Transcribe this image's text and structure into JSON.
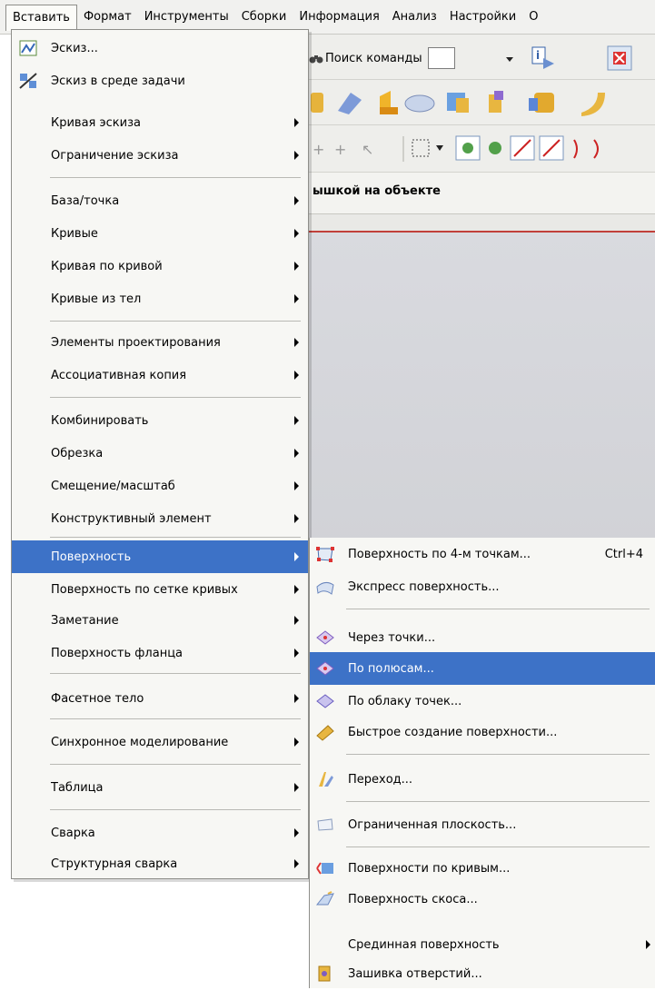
{
  "menubar": {
    "items": [
      {
        "label": "Вставить"
      },
      {
        "label": "Формат"
      },
      {
        "label": "Инструменты"
      },
      {
        "label": "Сборки"
      },
      {
        "label": "Информация"
      },
      {
        "label": "Анализ"
      },
      {
        "label": "Настройки"
      },
      {
        "label": "О"
      }
    ]
  },
  "toolbar": {
    "search_label": "Поиск команды"
  },
  "header": {
    "title": "ышкой на объекте"
  },
  "insert_menu": {
    "items": [
      {
        "label": "Эскиз...",
        "icon": "sketch-icon"
      },
      {
        "label": "Эскиз в среде задачи",
        "icon": "task-sketch-icon"
      },
      {
        "label": "Кривая эскиза"
      },
      {
        "label": "Ограничение эскиза"
      },
      {
        "label": "База/точка"
      },
      {
        "label": "Кривые"
      },
      {
        "label": "Кривая по кривой"
      },
      {
        "label": "Кривые из тел"
      },
      {
        "label": "Элементы проектирования"
      },
      {
        "label": "Ассоциативная копия"
      },
      {
        "label": "Комбинировать"
      },
      {
        "label": "Обрезка"
      },
      {
        "label": "Смещение/масштаб"
      },
      {
        "label": "Конструктивный элемент"
      },
      {
        "label": "Поверхность"
      },
      {
        "label": "Поверхность по сетке кривых"
      },
      {
        "label": "Заметание"
      },
      {
        "label": "Поверхность фланца"
      },
      {
        "label": "Фасетное тело"
      },
      {
        "label": "Синхронное моделирование"
      },
      {
        "label": "Таблица"
      },
      {
        "label": "Сварка"
      },
      {
        "label": "Структурная сварка"
      }
    ]
  },
  "surface_submenu": {
    "items": [
      {
        "label": "Поверхность по 4-м точкам...",
        "shortcut": "Ctrl+4"
      },
      {
        "label": "Экспресс поверхность..."
      },
      {
        "label": "Через точки..."
      },
      {
        "label": "По полюсам..."
      },
      {
        "label": "По облаку точек..."
      },
      {
        "label": "Быстрое создание поверхности..."
      },
      {
        "label": "Переход..."
      },
      {
        "label": "Ограниченная плоскость..."
      },
      {
        "label": "Поверхности по кривым..."
      },
      {
        "label": "Поверхность скоса..."
      },
      {
        "label": "Срединная поверхность"
      },
      {
        "label": "Зашивка отверстий..."
      }
    ]
  },
  "colors": {
    "highlight": "#3d72c7",
    "menu_bg": "#f7f7f4",
    "header_line": "#c1403a"
  }
}
